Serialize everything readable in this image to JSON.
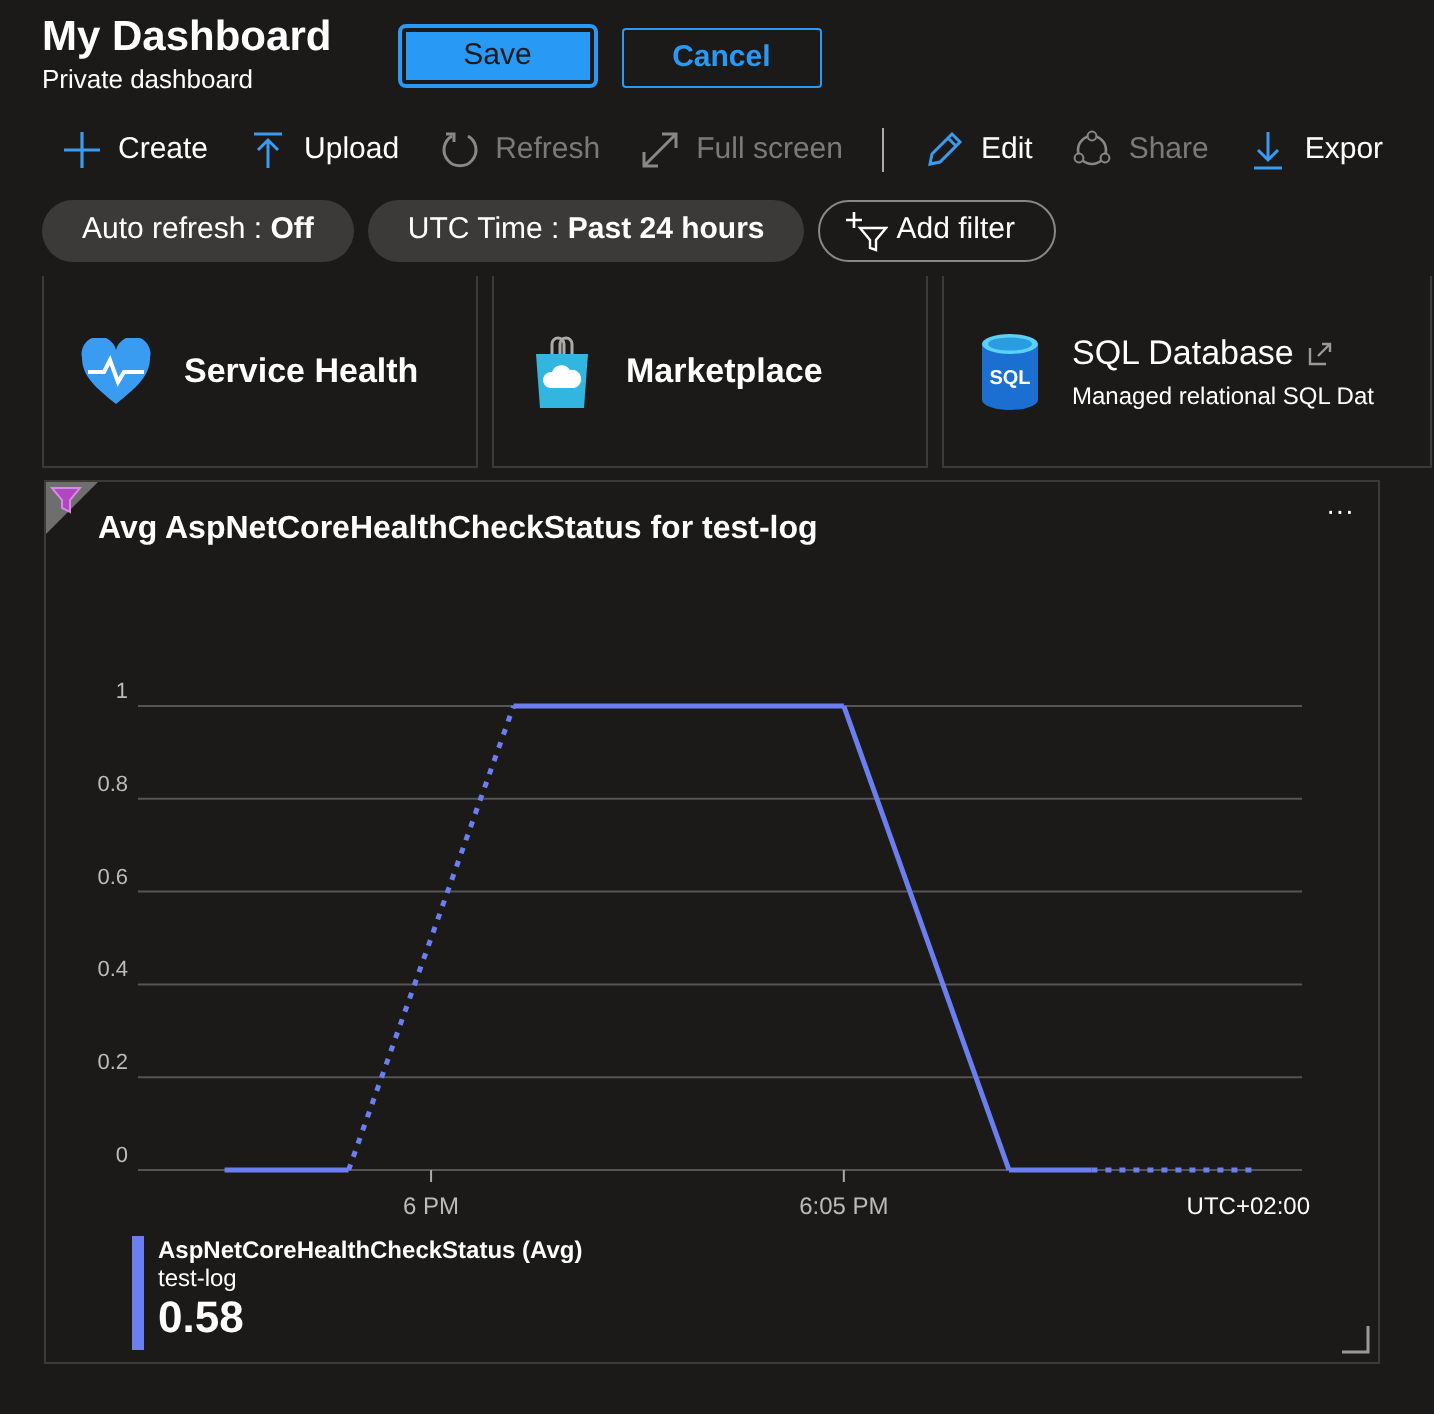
{
  "header": {
    "title": "My Dashboard",
    "subtitle": "Private dashboard",
    "buttons": [
      {
        "label": "Save",
        "kind": "primary"
      },
      {
        "label": "Cancel",
        "kind": "outline"
      }
    ]
  },
  "toolbar": [
    {
      "label": "Create",
      "disabled": false
    },
    {
      "label": "Upload",
      "disabled": false
    },
    {
      "label": "Refresh",
      "disabled": true
    },
    {
      "label": "Full screen",
      "disabled": true
    },
    {
      "label": "Edit",
      "disabled": false,
      "separator_before": true
    },
    {
      "label": "Share",
      "disabled": true
    },
    {
      "label": "Expor",
      "disabled": false
    }
  ],
  "filters": [
    {
      "label": "Auto refresh : ",
      "value": "Off",
      "kind": "pill"
    },
    {
      "label": "UTC Time : ",
      "value": "Past 24 hours",
      "kind": "pill"
    },
    {
      "label": "Add filter",
      "kind": "add"
    }
  ],
  "tiles": [
    {
      "title": "Service Health"
    },
    {
      "title": "Marketplace"
    },
    {
      "title": "SQL Database",
      "subtitle": "Managed relational SQL Dat",
      "icon_text": "SQL",
      "external": true
    }
  ],
  "chart_tile": {
    "title": "Avg AspNetCoreHealthCheckStatus for test-log",
    "menu": "···",
    "timezone": "UTC+02:00",
    "chart_data": {
      "type": "line",
      "grid": true,
      "categories": [
        null,
        null,
        null,
        null,
        null,
        null,
        null,
        "6 PM",
        null,
        null,
        null,
        null,
        null,
        null,
        null,
        null,
        null,
        "6:05 PM",
        null,
        null,
        null,
        null,
        null,
        null,
        null,
        null,
        null,
        null,
        null
      ],
      "ylim": [
        0,
        1
      ],
      "yticks": [
        {
          "value": 0,
          "label": "0"
        },
        {
          "value": 0.2,
          "label": "0.2"
        },
        {
          "value": 0.4,
          "label": "0.4"
        },
        {
          "value": 0.6,
          "label": "0.6"
        },
        {
          "value": 0.8,
          "label": "0.8"
        },
        {
          "value": 1,
          "label": "1"
        }
      ],
      "series": [
        {
          "name": "AspNetCoreHealthCheckStatus (Avg)",
          "color": "#6b7ff0",
          "values": [
            null,
            null,
            0,
            0,
            0,
            0,
            null,
            null,
            null,
            1,
            1,
            1,
            1,
            1,
            1,
            1,
            1,
            1,
            0.75,
            0.5,
            0.25,
            0,
            0,
            0,
            null,
            null,
            null,
            0,
            null
          ]
        }
      ]
    },
    "legend": {
      "resource": "test-log",
      "value": "0.58"
    }
  }
}
